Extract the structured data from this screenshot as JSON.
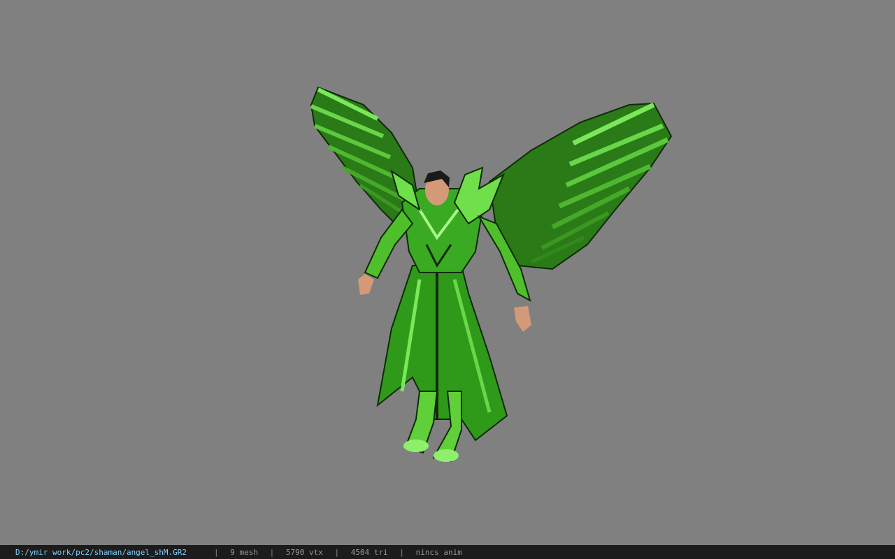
{
  "viewer": {
    "background_color": "#808080",
    "model_name": "angel_shM",
    "model_colors": {
      "armor_light": "#6fe04a",
      "armor_mid": "#34a81e",
      "armor_dark": "#0f2a08",
      "wing_green": "#2f8f1c",
      "skin": "#d49a78",
      "hair": "#1a1a1a"
    }
  },
  "status_bar": {
    "file_path": "D:/ymir work/pc2/shaman/angel_shM.GR2",
    "separator": "|",
    "mesh_count": "9 mesh",
    "vertex_count": "5790 vtx",
    "triangle_count": "4504 tri",
    "animation": "nincs anim"
  }
}
